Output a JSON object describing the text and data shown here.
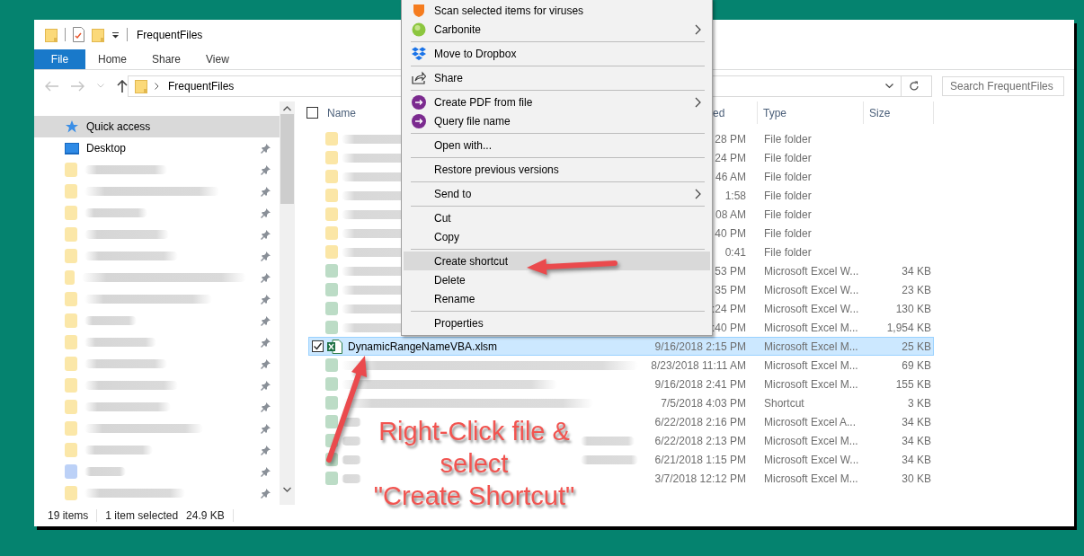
{
  "window": {
    "title": "FrequentFiles"
  },
  "ribbon": {
    "tabs": [
      {
        "label": "File",
        "kind": "menu"
      },
      {
        "label": "Home",
        "kind": "tab"
      },
      {
        "label": "Share",
        "kind": "tab"
      },
      {
        "label": "View",
        "kind": "tab"
      }
    ]
  },
  "address_bar": {
    "path": "FrequentFiles"
  },
  "search": {
    "placeholder": "Search FrequentFiles"
  },
  "sidebar": {
    "items": [
      {
        "label": "Quick access",
        "kind": "star",
        "selected": true,
        "pinned": false
      },
      {
        "label": "Desktop",
        "kind": "desktop",
        "selected": false,
        "pinned": true
      },
      {
        "kind": "folder",
        "selected": false,
        "pinned": true
      },
      {
        "kind": "folder",
        "selected": false,
        "pinned": true
      },
      {
        "kind": "folder",
        "selected": false,
        "pinned": true
      },
      {
        "kind": "folder",
        "selected": false,
        "pinned": true
      },
      {
        "kind": "folder",
        "selected": false,
        "pinned": true
      },
      {
        "kind": "folder",
        "selected": false,
        "pinned": true
      },
      {
        "kind": "folder",
        "selected": false,
        "pinned": true
      },
      {
        "kind": "folder",
        "selected": false,
        "pinned": true
      },
      {
        "kind": "folder",
        "selected": false,
        "pinned": true
      },
      {
        "kind": "folder",
        "selected": false,
        "pinned": true
      },
      {
        "kind": "folder",
        "selected": false,
        "pinned": true
      },
      {
        "kind": "folder",
        "selected": false,
        "pinned": true
      },
      {
        "kind": "folder",
        "selected": false,
        "pinned": true
      },
      {
        "kind": "folder",
        "selected": false,
        "pinned": true
      },
      {
        "kind": "cloud",
        "selected": false,
        "pinned": true
      },
      {
        "kind": "folder",
        "selected": false,
        "pinned": true
      }
    ]
  },
  "file_list": {
    "columns": [
      "Name",
      "ed",
      "Type",
      "Size"
    ],
    "header_checked": false,
    "rows": [
      {
        "kind": "folder",
        "date": "28 PM",
        "type": "File folder",
        "selected": false
      },
      {
        "kind": "folder",
        "date": "24 PM",
        "type": "File folder",
        "selected": false
      },
      {
        "kind": "folder",
        "date": "46 AM",
        "type": "File folder",
        "selected": false
      },
      {
        "kind": "folder",
        "date": "1:58",
        "type": "File folder",
        "selected": false
      },
      {
        "kind": "folder",
        "date": "08 AM",
        "type": "File folder",
        "selected": false
      },
      {
        "kind": "folder",
        "date": "40 PM",
        "type": "File folder",
        "selected": false
      },
      {
        "kind": "folder",
        "date": "0:41",
        "type": "File folder",
        "selected": false
      },
      {
        "kind": "excel",
        "date": "53 PM",
        "type": "Microsoft Excel W...",
        "size": "34 KB",
        "selected": false
      },
      {
        "kind": "excel",
        "date": "35 PM",
        "type": "Microsoft Excel W...",
        "size": "23 KB",
        "selected": false
      },
      {
        "kind": "excel",
        "date": ":24 PM",
        "type": "Microsoft Excel W...",
        "size": "130 KB",
        "selected": false
      },
      {
        "kind": "excel",
        "date": ":40 PM",
        "type": "Microsoft Excel M...",
        "size": "1,954 KB",
        "selected": false
      },
      {
        "kind": "excel",
        "name": "DynamicRangeNameVBA.xlsm",
        "date": "9/16/2018 2:15 PM",
        "type": "Microsoft Excel M...",
        "size": "25 KB",
        "selected": true
      },
      {
        "kind": "excel",
        "date": "8/23/2018 11:11 AM",
        "type": "Microsoft Excel M...",
        "size": "69 KB",
        "selected": false
      },
      {
        "kind": "excel",
        "date": "9/16/2018 2:41 PM",
        "type": "Microsoft Excel M...",
        "size": "155 KB",
        "selected": false
      },
      {
        "kind": "excel",
        "date": "7/5/2018 4:03 PM",
        "type": "Shortcut",
        "size": "3 KB",
        "selected": false
      },
      {
        "kind": "excel",
        "date": "6/22/2018 2:16 PM",
        "type": "Microsoft Excel A...",
        "size": "34 KB",
        "selected": false
      },
      {
        "kind": "excel",
        "date": "6/22/2018 2:13 PM",
        "type": "Microsoft Excel M...",
        "size": "34 KB",
        "selected": false
      },
      {
        "kind": "excel",
        "date": "6/21/2018 1:15 PM",
        "type": "Microsoft Excel W...",
        "size": "34 KB",
        "selected": false
      },
      {
        "kind": "excel",
        "date": "3/7/2018 12:12 PM",
        "type": "Microsoft Excel M...",
        "size": "30 KB",
        "selected": false
      }
    ]
  },
  "status_bar": {
    "item_count": "19 items",
    "selection": "1 item selected",
    "selection_size": "24.9 KB"
  },
  "context_menu": {
    "items": [
      {
        "kind": "item",
        "label": "Scan selected items for viruses",
        "submenu": false,
        "selected": false
      },
      {
        "kind": "item",
        "label": "Carbonite",
        "submenu": true,
        "selected": false
      },
      {
        "kind": "separator"
      },
      {
        "kind": "item",
        "label": "Move to Dropbox",
        "submenu": false,
        "selected": false
      },
      {
        "kind": "separator"
      },
      {
        "kind": "item",
        "label": "Share",
        "submenu": false,
        "selected": false
      },
      {
        "kind": "separator"
      },
      {
        "kind": "item",
        "label": "Create PDF from file",
        "submenu": true,
        "selected": false
      },
      {
        "kind": "item",
        "label": "Query file name",
        "submenu": false,
        "selected": false
      },
      {
        "kind": "separator"
      },
      {
        "kind": "item",
        "label": "Open with...",
        "submenu": false,
        "selected": false
      },
      {
        "kind": "separator"
      },
      {
        "kind": "item",
        "label": "Restore previous versions",
        "submenu": false,
        "selected": false
      },
      {
        "kind": "separator"
      },
      {
        "kind": "item",
        "label": "Send to",
        "submenu": true,
        "selected": false
      },
      {
        "kind": "separator"
      },
      {
        "kind": "item",
        "label": "Cut",
        "submenu": false,
        "selected": false
      },
      {
        "kind": "item",
        "label": "Copy",
        "submenu": false,
        "selected": false
      },
      {
        "kind": "separator"
      },
      {
        "kind": "item",
        "label": "Create shortcut",
        "submenu": false,
        "selected": true
      },
      {
        "kind": "item",
        "label": "Delete",
        "submenu": false,
        "selected": false
      },
      {
        "kind": "item",
        "label": "Rename",
        "submenu": false,
        "selected": false
      },
      {
        "kind": "separator"
      },
      {
        "kind": "item",
        "label": "Properties",
        "submenu": false,
        "selected": false
      }
    ]
  },
  "annotation": {
    "lines": [
      "Right-Click file &",
      "select",
      "\"Create Shortcut\""
    ]
  }
}
